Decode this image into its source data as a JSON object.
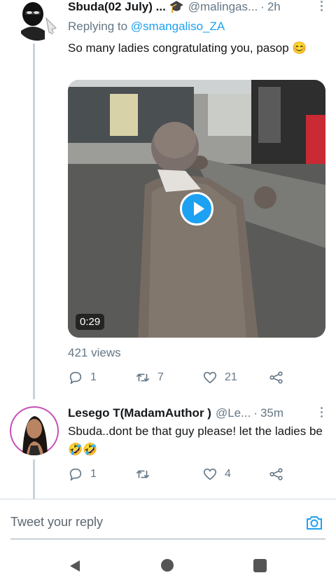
{
  "tweets": [
    {
      "name": "Sbuda(02 July) ... 🎓",
      "handle": "@malingas...",
      "time": "2h",
      "reply_label": "Replying to",
      "reply_handle": "@smangaliso_ZA",
      "text": "So many ladies congratulating you, pasop 😊",
      "video": {
        "duration": "0:29"
      },
      "views": "421 views",
      "stats": {
        "replies": "1",
        "retweets": "7",
        "likes": "21"
      }
    },
    {
      "name": "Lesego T(MadamAuthor )",
      "handle": "@Le...",
      "time": "35m",
      "text": "Sbuda..dont be that guy please! let the ladies be🤣🤣",
      "stats": {
        "replies": "1",
        "retweets": "",
        "likes": "4"
      }
    }
  ],
  "composer": {
    "placeholder": "Tweet your reply"
  },
  "icons": {
    "reply": "reply-icon",
    "retweet": "retweet-icon",
    "like": "heart-icon",
    "share": "share-icon",
    "camera": "camera-icon",
    "more": "more-icon"
  },
  "colors": {
    "link": "#1da1f2",
    "secondary_text": "#657786",
    "play_button": "#1da1f2"
  }
}
